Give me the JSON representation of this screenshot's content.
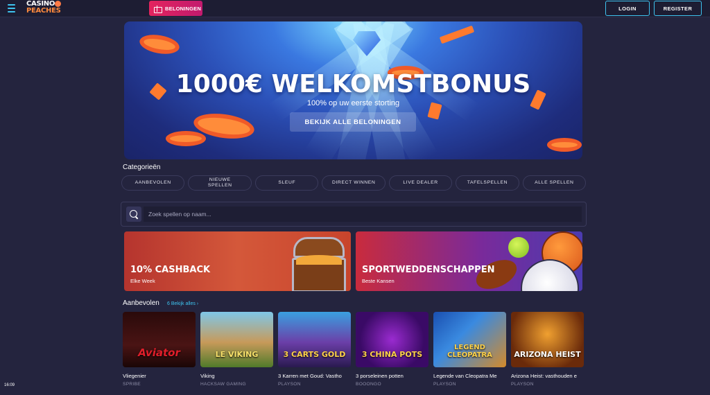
{
  "header": {
    "logo_line1": "CASINO",
    "logo_line2": "PEACHES",
    "rewards_label": "BELONINGEN",
    "login_label": "LOGIN",
    "register_label": "REGISTER"
  },
  "hero": {
    "title": "1000€ WELKOMSTBONUS",
    "subtitle": "100% op uw eerste storting",
    "cta_label": "BEKIJK ALLE BELONINGEN"
  },
  "categories": {
    "title": "Categorieën",
    "items": [
      {
        "label": "AANBEVOLEN"
      },
      {
        "label": "NIEUWE SPELLEN"
      },
      {
        "label": "SLEUF"
      },
      {
        "label": "DIRECT WINNEN"
      },
      {
        "label": "LIVE DEALER"
      },
      {
        "label": "TAFELSPELLEN"
      },
      {
        "label": "ALLE SPELLEN"
      }
    ]
  },
  "search": {
    "placeholder": "Zoek spellen op naam..."
  },
  "promos": [
    {
      "title": "10% CASHBACK",
      "subtitle": "Elke Week"
    },
    {
      "title": "SPORTWEDDENSCHAPPEN",
      "subtitle": "Beste Kansen"
    }
  ],
  "recommended": {
    "title": "Aanbevolen",
    "view_all": "6 Bekijk alles",
    "games": [
      {
        "name": "Vliegenier",
        "provider": "SPRIBE",
        "art_text": "Aviator"
      },
      {
        "name": "Viking",
        "provider": "HACKSAW GAMING",
        "art_text": "LE VIKING"
      },
      {
        "name": "3 Karren met Goud: Vastho",
        "provider": "PLAYSON",
        "art_text": "3 CARTS GOLD"
      },
      {
        "name": "3 porseleinen potten",
        "provider": "BOOONGO",
        "art_text": "3 CHINA POTS"
      },
      {
        "name": "Legende van Cleopatra Me",
        "provider": "PLAYSON",
        "art_text": "LEGEND CLEOPATRA"
      },
      {
        "name": "Arizona Heist: vasthouden e",
        "provider": "PLAYSON",
        "art_text": "ARIZONA HEIST"
      }
    ]
  },
  "status": {
    "clock": "16:09"
  },
  "colors": {
    "accent": "#3ec4f0",
    "rewards": "#e3245e",
    "background": "#24243e"
  }
}
